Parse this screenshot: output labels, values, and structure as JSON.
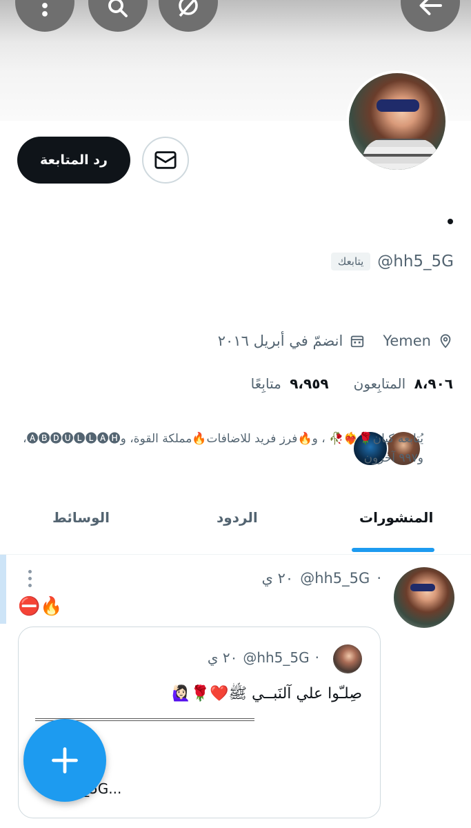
{
  "header": {
    "icons": [
      "more-icon",
      "search-icon",
      "grok-icon",
      "back-arrow-icon"
    ]
  },
  "profile": {
    "name": "•",
    "handle": "@hh5_5G",
    "follows_you": "يتابعك",
    "follow_back_label": "رد المتابعة",
    "location": "Yemen",
    "joined": "انضمّ في أبريل ٢٠١٦",
    "followers_count": "٨،٩٠٦",
    "followers_label": "المتابِعون",
    "following_count": "٩،٩٥٩",
    "following_label": "متابِعًا",
    "followed_by": "يُتابعه كيان🌹❤️‍🔥🥀 ، و🔥فرز فريد للاضافات🔥مملكة القوة، و🅐🅑🅓🅤🅛🅛🅐🅗، و٩٩٧ آخرون"
  },
  "tabs": [
    {
      "label": "المنشورات",
      "active": true
    },
    {
      "label": "الردود",
      "active": false
    },
    {
      "label": "الوسائط",
      "active": false
    }
  ],
  "tweet": {
    "handle": "@hh5_5G",
    "time": "٢٠ ي",
    "separator": "·",
    "text": "⛔🔥",
    "quote": {
      "handle": "@hh5_5G",
      "time": "٢٠ ي",
      "separator": "·",
      "text": "صِلـّوا علي آلنَبــي ﷺ❤️🌹🙋🏻‍♀️",
      "truncated": "@hh5_5G..."
    }
  },
  "fab": {
    "icon": "plus-icon"
  },
  "colors": {
    "accent": "#1d9bf0",
    "primary_button": "#0f1419",
    "muted": "#536471"
  }
}
